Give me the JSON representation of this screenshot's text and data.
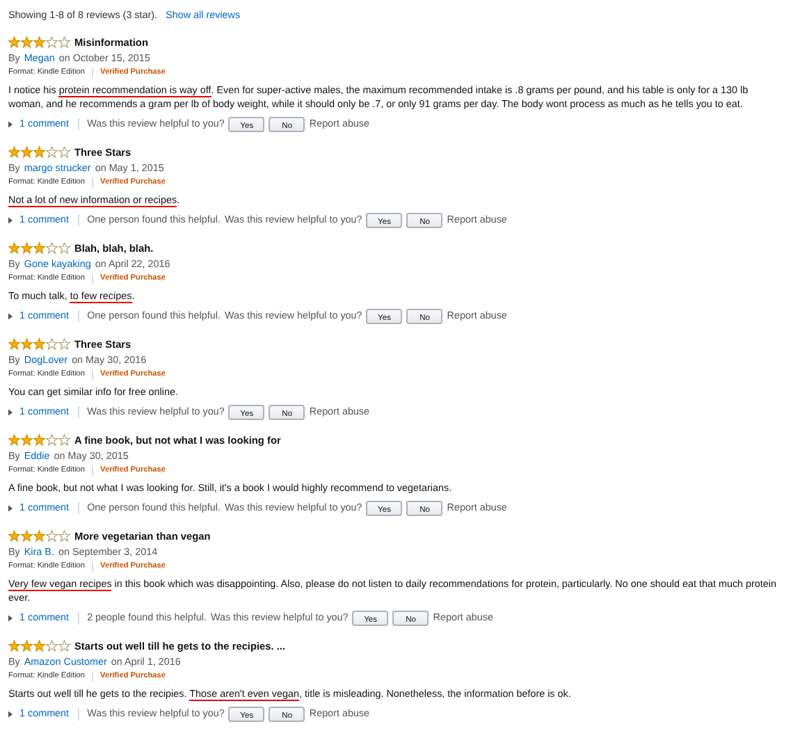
{
  "summary": {
    "text": "Showing 1-8 of 8 reviews (3 star).",
    "link": "Show all reviews"
  },
  "reviews": [
    {
      "stars": 3,
      "title": "Misinformation",
      "by": "By",
      "author": "Megan",
      "date": "on October 15, 2015",
      "format": "Format: Kindle Edition",
      "verified": "Verified Purchase",
      "body": [
        {
          "text": "I notice his ",
          "marked": false
        },
        {
          "text": "protein recommendation is way off",
          "marked": true
        },
        {
          "text": ". Even for super-active males, the maximum recommended intake is .8 grams per pound, and his table is only for a 130 lb woman, and he recommends a gram per lb of body weight, while it should only be .7, or only 91 grams per day. The body wont process as much as he tells you to eat.",
          "marked": false
        }
      ],
      "comments": "1 comment",
      "question": "Was this review helpful to you?",
      "yes": "Yes",
      "no": "No",
      "report": "Report abuse"
    },
    {
      "stars": 3,
      "title": "Three Stars",
      "by": "By",
      "author": "margo strucker",
      "date": "on May 1, 2015",
      "format": "Format: Kindle Edition",
      "verified": "Verified Purchase",
      "body": [
        {
          "text": "Not a lot of new information or recipes",
          "marked": true
        },
        {
          "text": ".",
          "marked": false
        }
      ],
      "comments": "1 comment",
      "helpful": "One person found this helpful.",
      "question": "Was this review helpful to you?",
      "yes": "Yes",
      "no": "No",
      "report": "Report abuse"
    },
    {
      "stars": 3,
      "title": "Blah, blah, blah.",
      "by": "By",
      "author": "Gone kayaking",
      "date": "on April 22, 2016",
      "format": "Format: Kindle Edition",
      "verified": "Verified Purchase",
      "body": [
        {
          "text": "To much talk, ",
          "marked": false
        },
        {
          "text": "to few recipes",
          "marked": true
        },
        {
          "text": ".",
          "marked": false
        }
      ],
      "comments": "1 comment",
      "helpful": "One person found this helpful.",
      "question": "Was this review helpful to you?",
      "yes": "Yes",
      "no": "No",
      "report": "Report abuse"
    },
    {
      "stars": 3,
      "title": "Three Stars",
      "by": "By",
      "author": "DogLover",
      "date": "on May 30, 2016",
      "format": "Format: Kindle Edition",
      "verified": "Verified Purchase",
      "body": [
        {
          "text": "You can get similar info for free online.",
          "marked": false
        }
      ],
      "comments": "1 comment",
      "question": "Was this review helpful to you?",
      "yes": "Yes",
      "no": "No",
      "report": "Report abuse"
    },
    {
      "stars": 3,
      "title": "A fine book, but not what I was looking for",
      "by": "By",
      "author": "Eddie",
      "date": "on May 30, 2015",
      "format": "Format: Kindle Edition",
      "verified": "Verified Purchase",
      "body": [
        {
          "text": "A fine book, but not what I was looking for. Still, it's a book I would highly recommend to vegetarians.",
          "marked": false
        }
      ],
      "comments": "1 comment",
      "helpful": "One person found this helpful.",
      "question": "Was this review helpful to you?",
      "yes": "Yes",
      "no": "No",
      "report": "Report abuse"
    },
    {
      "stars": 3,
      "title": "More vegetarian than vegan",
      "by": "By",
      "author": "Kira B.",
      "date": "on September 3, 2014",
      "format": "Format: Kindle Edition",
      "verified": "Verified Purchase",
      "body": [
        {
          "text": "Very few vegan recipes",
          "marked": true
        },
        {
          "text": " in this book which was disappointing. Also, please do not listen to daily recommendations for protein, particularly. No one should eat that much protein ever.",
          "marked": false
        }
      ],
      "comments": "1 comment",
      "helpful": "2 people found this helpful.",
      "question": "Was this review helpful to you?",
      "yes": "Yes",
      "no": "No",
      "report": "Report abuse"
    },
    {
      "stars": 3,
      "title": "Starts out well till he gets to the recipies. ...",
      "by": "By",
      "author": "Amazon Customer",
      "date": "on April 1, 2016",
      "format": "Format: Kindle Edition",
      "verified": "Verified Purchase",
      "body": [
        {
          "text": "Starts out well till he gets to the recipies. ",
          "marked": false
        },
        {
          "text": "Those aren't even vegan",
          "marked": true
        },
        {
          "text": ", title is misleading. Nonetheless, the information before is ok.",
          "marked": false
        }
      ],
      "comments": "1 comment",
      "question": "Was this review helpful to you?",
      "yes": "Yes",
      "no": "No",
      "report": "Report abuse"
    }
  ]
}
